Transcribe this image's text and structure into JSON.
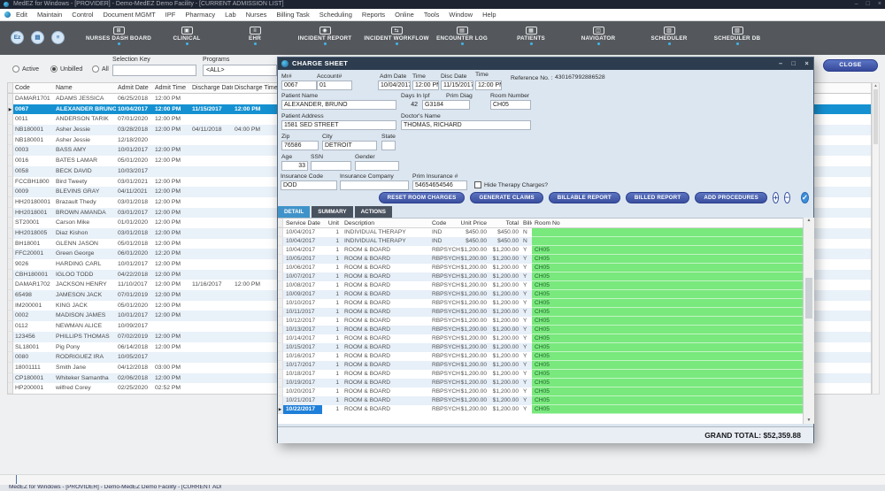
{
  "titlebar": {
    "title": "MedEZ for Windows - [PROVIDER] - Demo-MedEZ Demo Facility - [CURRENT ADMISSION LIST]",
    "controls": [
      {
        "name": "window-minimize",
        "glyph": "–"
      },
      {
        "name": "window-maximize",
        "glyph": "□"
      },
      {
        "name": "window-close",
        "glyph": "×"
      }
    ]
  },
  "menubar": {
    "items": [
      "Edit",
      "Maintain",
      "Control",
      "Document MGMT",
      "IPF",
      "Pharmacy",
      "Lab",
      "Nurses",
      "Billing Task",
      "Scheduling",
      "Reports",
      "Online",
      "Tools",
      "Window",
      "Help"
    ]
  },
  "toolbar": {
    "quick_icons": [
      {
        "name": "ez-logo-icon",
        "glyph": "Ez"
      },
      {
        "name": "patient-chart-icon",
        "glyph": "▤"
      },
      {
        "name": "printer-icon",
        "glyph": "≡"
      }
    ],
    "buttons": [
      {
        "label": "NURSES DASH BOARD",
        "icon": "⊞"
      },
      {
        "label": "CLINICAL",
        "icon": "▣"
      },
      {
        "label": "EHR",
        "icon": "≡"
      },
      {
        "label": "INCIDENT REPORT",
        "icon": "◉"
      },
      {
        "label": "INCIDENT WORKFLOW",
        "icon": "⇆"
      },
      {
        "label": "ENCOUNTER LOG",
        "icon": "▤"
      },
      {
        "label": "PATIENTS",
        "icon": "▦"
      },
      {
        "label": "NAVIGATOR",
        "icon": "◫"
      },
      {
        "label": "SCHEDULER",
        "icon": "▥"
      },
      {
        "label": "SCHEDULER DB",
        "icon": "▧"
      }
    ]
  },
  "filter_panel": {
    "radios": [
      {
        "label": "Active",
        "selected": false
      },
      {
        "label": "Unbilled",
        "selected": true
      },
      {
        "label": "All",
        "selected": false
      }
    ],
    "selection_key_label": "Selection Key",
    "selection_key_value": "",
    "programs_label": "Programs",
    "programs_value": "<ALL>"
  },
  "close_button_label": "CLOSE",
  "icons": {
    "row_marker": "▶",
    "scroll_up": "▲",
    "scroll_down": "▼"
  },
  "patient_table": {
    "columns": [
      "Code",
      "Name",
      "Admit Date",
      "Admit Time",
      "Discharge Date",
      "Discharge Time"
    ],
    "selected_index": 1,
    "rows": [
      {
        "code": "DAMAR1701",
        "name": "ADAMS JESSICA",
        "admit_date": "06/25/2018",
        "admit_time": "12:00 PM",
        "discharge_date": "",
        "discharge_time": ""
      },
      {
        "code": "0067",
        "name": "ALEXANDER BRUNO",
        "admit_date": "10/04/2017",
        "admit_time": "12:00 PM",
        "discharge_date": "11/15/2017",
        "discharge_time": "12:00 PM"
      },
      {
        "code": "0011",
        "name": "ANDERSON TARIK",
        "admit_date": "07/01/2020",
        "admit_time": "12:00 PM",
        "discharge_date": "",
        "discharge_time": ""
      },
      {
        "code": "NB180001",
        "name": "Asher Jessie",
        "admit_date": "03/28/2018",
        "admit_time": "12:00 PM",
        "discharge_date": "04/11/2018",
        "discharge_time": "04:00 PM"
      },
      {
        "code": "NB180001",
        "name": "Asher Jessie",
        "admit_date": "12/18/2020",
        "admit_time": "",
        "discharge_date": "",
        "discharge_time": ""
      },
      {
        "code": "0003",
        "name": "BASS AMY",
        "admit_date": "10/01/2017",
        "admit_time": "12:00 PM",
        "discharge_date": "",
        "discharge_time": ""
      },
      {
        "code": "0016",
        "name": "BATES LAMAR",
        "admit_date": "05/01/2020",
        "admit_time": "12:00 PM",
        "discharge_date": "",
        "discharge_time": ""
      },
      {
        "code": "0058",
        "name": "BECK DAVID",
        "admit_date": "10/03/2017",
        "admit_time": "",
        "discharge_date": "",
        "discharge_time": ""
      },
      {
        "code": "FCCBH1800",
        "name": "Bird Tweety",
        "admit_date": "03/01/2021",
        "admit_time": "12:00 PM",
        "discharge_date": "",
        "discharge_time": ""
      },
      {
        "code": "0009",
        "name": "BLEVINS GRAY",
        "admit_date": "04/11/2021",
        "admit_time": "12:00 PM",
        "discharge_date": "",
        "discharge_time": ""
      },
      {
        "code": "HH20180001",
        "name": "Brazault Thedy",
        "admit_date": "03/01/2018",
        "admit_time": "12:00 PM",
        "discharge_date": "",
        "discharge_time": ""
      },
      {
        "code": "HH2018001",
        "name": "BROWN AMANDA",
        "admit_date": "03/01/2017",
        "admit_time": "12:00 PM",
        "discharge_date": "",
        "discharge_time": ""
      },
      {
        "code": "ST20001",
        "name": "Carson Mike",
        "admit_date": "01/01/2020",
        "admit_time": "12:00 PM",
        "discharge_date": "",
        "discharge_time": ""
      },
      {
        "code": "HH2018005",
        "name": "Diaz Kishon",
        "admit_date": "03/01/2018",
        "admit_time": "12:00 PM",
        "discharge_date": "",
        "discharge_time": ""
      },
      {
        "code": "BH18001",
        "name": "GLENN JASON",
        "admit_date": "05/01/2018",
        "admit_time": "12:00 PM",
        "discharge_date": "",
        "discharge_time": ""
      },
      {
        "code": "FFC20001",
        "name": "Green George",
        "admit_date": "06/01/2020",
        "admit_time": "12:20 PM",
        "discharge_date": "",
        "discharge_time": ""
      },
      {
        "code": "9026",
        "name": "HARDING CARL",
        "admit_date": "10/01/2017",
        "admit_time": "12:00 PM",
        "discharge_date": "",
        "discharge_time": ""
      },
      {
        "code": "CBH180001",
        "name": "IGLOO TODD",
        "admit_date": "04/22/2018",
        "admit_time": "12:00 PM",
        "discharge_date": "",
        "discharge_time": ""
      },
      {
        "code": "DAMAR1702",
        "name": "JACKSON HENRY",
        "admit_date": "11/10/2017",
        "admit_time": "12:00 PM",
        "discharge_date": "11/16/2017",
        "discharge_time": "12:00 PM"
      },
      {
        "code": "65498",
        "name": "JAMESON JACK",
        "admit_date": "07/01/2019",
        "admit_time": "12:00 PM",
        "discharge_date": "",
        "discharge_time": ""
      },
      {
        "code": "IM200001",
        "name": "KING JACK",
        "admit_date": "05/01/2020",
        "admit_time": "12:00 PM",
        "discharge_date": "",
        "discharge_time": ""
      },
      {
        "code": "0002",
        "name": "MADISON JAMES",
        "admit_date": "10/01/2017",
        "admit_time": "12:00 PM",
        "discharge_date": "",
        "discharge_time": ""
      },
      {
        "code": "0112",
        "name": "NEWMAN ALICE",
        "admit_date": "10/09/2017",
        "admit_time": "",
        "discharge_date": "",
        "discharge_time": ""
      },
      {
        "code": "123456",
        "name": "PHILLIPS THOMAS",
        "admit_date": "07/02/2019",
        "admit_time": "12:00 PM",
        "discharge_date": "",
        "discharge_time": ""
      },
      {
        "code": "SL18001",
        "name": "Pig Pony",
        "admit_date": "06/14/2018",
        "admit_time": "12:00 PM",
        "discharge_date": "",
        "discharge_time": ""
      },
      {
        "code": "0080",
        "name": "RODRIGUEZ IRA",
        "admit_date": "10/05/2017",
        "admit_time": "",
        "discharge_date": "",
        "discharge_time": ""
      },
      {
        "code": "18001111",
        "name": "Smith Jane",
        "admit_date": "04/12/2018",
        "admit_time": "03:00 PM",
        "discharge_date": "",
        "discharge_time": ""
      },
      {
        "code": "CP180001",
        "name": "Whiteker Samantha",
        "admit_date": "02/06/2018",
        "admit_time": "12:00 PM",
        "discharge_date": "",
        "discharge_time": ""
      },
      {
        "code": "HP200001",
        "name": "wilfred Corey",
        "admit_date": "02/25/2020",
        "admit_time": "02:52 PM",
        "discharge_date": "",
        "discharge_time": ""
      }
    ]
  },
  "charge_sheet": {
    "title": "CHARGE SHEET",
    "window_controls": [
      {
        "name": "dialog-minimize",
        "glyph": "–"
      },
      {
        "name": "dialog-maximize",
        "glyph": "□"
      },
      {
        "name": "dialog-close",
        "glyph": "×"
      }
    ],
    "fields": {
      "mr": {
        "label": "Mr#",
        "value": "0067"
      },
      "account": {
        "label": "Account#",
        "value": "01"
      },
      "adm_date": {
        "label": "Adm Date",
        "value": "10/04/2017"
      },
      "adm_time": {
        "label": "Time",
        "value": "12:00 PM"
      },
      "disc_date": {
        "label": "Disc Date",
        "value": "11/15/2017"
      },
      "disc_time": {
        "label": "Time",
        "value": "12:00 PM"
      },
      "reference": {
        "label": "Reference No. :",
        "value": "430167992886528"
      },
      "patient_name": {
        "label": "Patient Name",
        "value": "ALEXANDER, BRUNO"
      },
      "days_in_ipf": {
        "label": "Days In Ipf",
        "value": "42"
      },
      "prim_diag": {
        "label": "Prim Diag",
        "value": "G3184"
      },
      "room_number": {
        "label": "Room Number",
        "value": "CH05"
      },
      "patient_address": {
        "label": "Patient Address",
        "value": "1581 SED STREET"
      },
      "doctor": {
        "label": "Doctor's Name",
        "value": "THOMAS, RICHARD"
      },
      "zip": {
        "label": "Zip",
        "value": "76586"
      },
      "city": {
        "label": "City",
        "value": "DETROIT"
      },
      "state": {
        "label": "State",
        "value": ""
      },
      "age": {
        "label": "Age",
        "value": "33"
      },
      "ssn": {
        "label": "SSN",
        "value": ""
      },
      "gender": {
        "label": "Gender",
        "value": ""
      },
      "insurance_code": {
        "label": "Insurance Code",
        "value": "DOD"
      },
      "insurance_company": {
        "label": "Insurance Company",
        "value": ""
      },
      "prim_insurance": {
        "label": "Prim Insurance #",
        "value": "54654654546"
      },
      "hide_therapy": {
        "label": "Hide Therapy Charges?",
        "checked": false
      }
    },
    "action_buttons": [
      "RESET ROOM CHARGES",
      "GENERATE CLAIMS",
      "BILLABLE REPORT",
      "BILLED REPORT",
      "ADD PROCEDURES"
    ],
    "icon_buttons": [
      {
        "name": "add-charge-button",
        "glyph": "+",
        "filled": false
      },
      {
        "name": "remove-charge-button",
        "glyph": "−",
        "filled": false
      },
      {
        "name": "confirm-button",
        "glyph": "✓",
        "filled": true
      }
    ],
    "tabs": [
      {
        "label": "DETAIL",
        "active": true
      },
      {
        "label": "SUMMARY",
        "active": false
      },
      {
        "label": "ACTIONS",
        "active": false
      }
    ],
    "grid": {
      "columns": [
        "Service Date",
        "Unit",
        "Description",
        "Code",
        "Unit Price",
        "Total",
        "Billed",
        "Room No"
      ],
      "selected_index": 20,
      "rows": [
        [
          "10/04/2017",
          "1",
          "INDIVIDUAL THERAPY",
          "IND",
          "$450.00",
          "$450.00",
          "N",
          ""
        ],
        [
          "10/04/2017",
          "1",
          "INDIVIDUAL THERAPY",
          "IND",
          "$450.00",
          "$450.00",
          "N",
          ""
        ],
        [
          "10/04/2017",
          "1",
          "ROOM & BOARD",
          "RBPSYCH",
          "$1,200.00",
          "$1,200.00",
          "Y",
          "CH05"
        ],
        [
          "10/05/2017",
          "1",
          "ROOM & BOARD",
          "RBPSYCH",
          "$1,200.00",
          "$1,200.00",
          "Y",
          "CH05"
        ],
        [
          "10/06/2017",
          "1",
          "ROOM & BOARD",
          "RBPSYCH",
          "$1,200.00",
          "$1,200.00",
          "Y",
          "CH05"
        ],
        [
          "10/07/2017",
          "1",
          "ROOM & BOARD",
          "RBPSYCH",
          "$1,200.00",
          "$1,200.00",
          "Y",
          "CH05"
        ],
        [
          "10/08/2017",
          "1",
          "ROOM & BOARD",
          "RBPSYCH",
          "$1,200.00",
          "$1,200.00",
          "Y",
          "CH05"
        ],
        [
          "10/09/2017",
          "1",
          "ROOM & BOARD",
          "RBPSYCH",
          "$1,200.00",
          "$1,200.00",
          "Y",
          "CH05"
        ],
        [
          "10/10/2017",
          "1",
          "ROOM & BOARD",
          "RBPSYCH",
          "$1,200.00",
          "$1,200.00",
          "Y",
          "CH05"
        ],
        [
          "10/11/2017",
          "1",
          "ROOM & BOARD",
          "RBPSYCH",
          "$1,200.00",
          "$1,200.00",
          "Y",
          "CH05"
        ],
        [
          "10/12/2017",
          "1",
          "ROOM & BOARD",
          "RBPSYCH",
          "$1,200.00",
          "$1,200.00",
          "Y",
          "CH05"
        ],
        [
          "10/13/2017",
          "1",
          "ROOM & BOARD",
          "RBPSYCH",
          "$1,200.00",
          "$1,200.00",
          "Y",
          "CH05"
        ],
        [
          "10/14/2017",
          "1",
          "ROOM & BOARD",
          "RBPSYCH",
          "$1,200.00",
          "$1,200.00",
          "Y",
          "CH05"
        ],
        [
          "10/15/2017",
          "1",
          "ROOM & BOARD",
          "RBPSYCH",
          "$1,200.00",
          "$1,200.00",
          "Y",
          "CH05"
        ],
        [
          "10/16/2017",
          "1",
          "ROOM & BOARD",
          "RBPSYCH",
          "$1,200.00",
          "$1,200.00",
          "Y",
          "CH05"
        ],
        [
          "10/17/2017",
          "1",
          "ROOM & BOARD",
          "RBPSYCH",
          "$1,200.00",
          "$1,200.00",
          "Y",
          "CH05"
        ],
        [
          "10/18/2017",
          "1",
          "ROOM & BOARD",
          "RBPSYCH",
          "$1,200.00",
          "$1,200.00",
          "Y",
          "CH05"
        ],
        [
          "10/19/2017",
          "1",
          "ROOM & BOARD",
          "RBPSYCH",
          "$1,200.00",
          "$1,200.00",
          "Y",
          "CH05"
        ],
        [
          "10/20/2017",
          "1",
          "ROOM & BOARD",
          "RBPSYCH",
          "$1,200.00",
          "$1,200.00",
          "Y",
          "CH05"
        ],
        [
          "10/21/2017",
          "1",
          "ROOM & BOARD",
          "RBPSYCH",
          "$1,200.00",
          "$1,200.00",
          "Y",
          "CH05"
        ],
        [
          "10/22/2017",
          "1",
          "ROOM & BOARD",
          "RBPSYCH",
          "$1,200.00",
          "$1,200.00",
          "Y",
          "CH05"
        ]
      ]
    },
    "grand_total": "GRAND TOTAL: $52,359.88"
  }
}
